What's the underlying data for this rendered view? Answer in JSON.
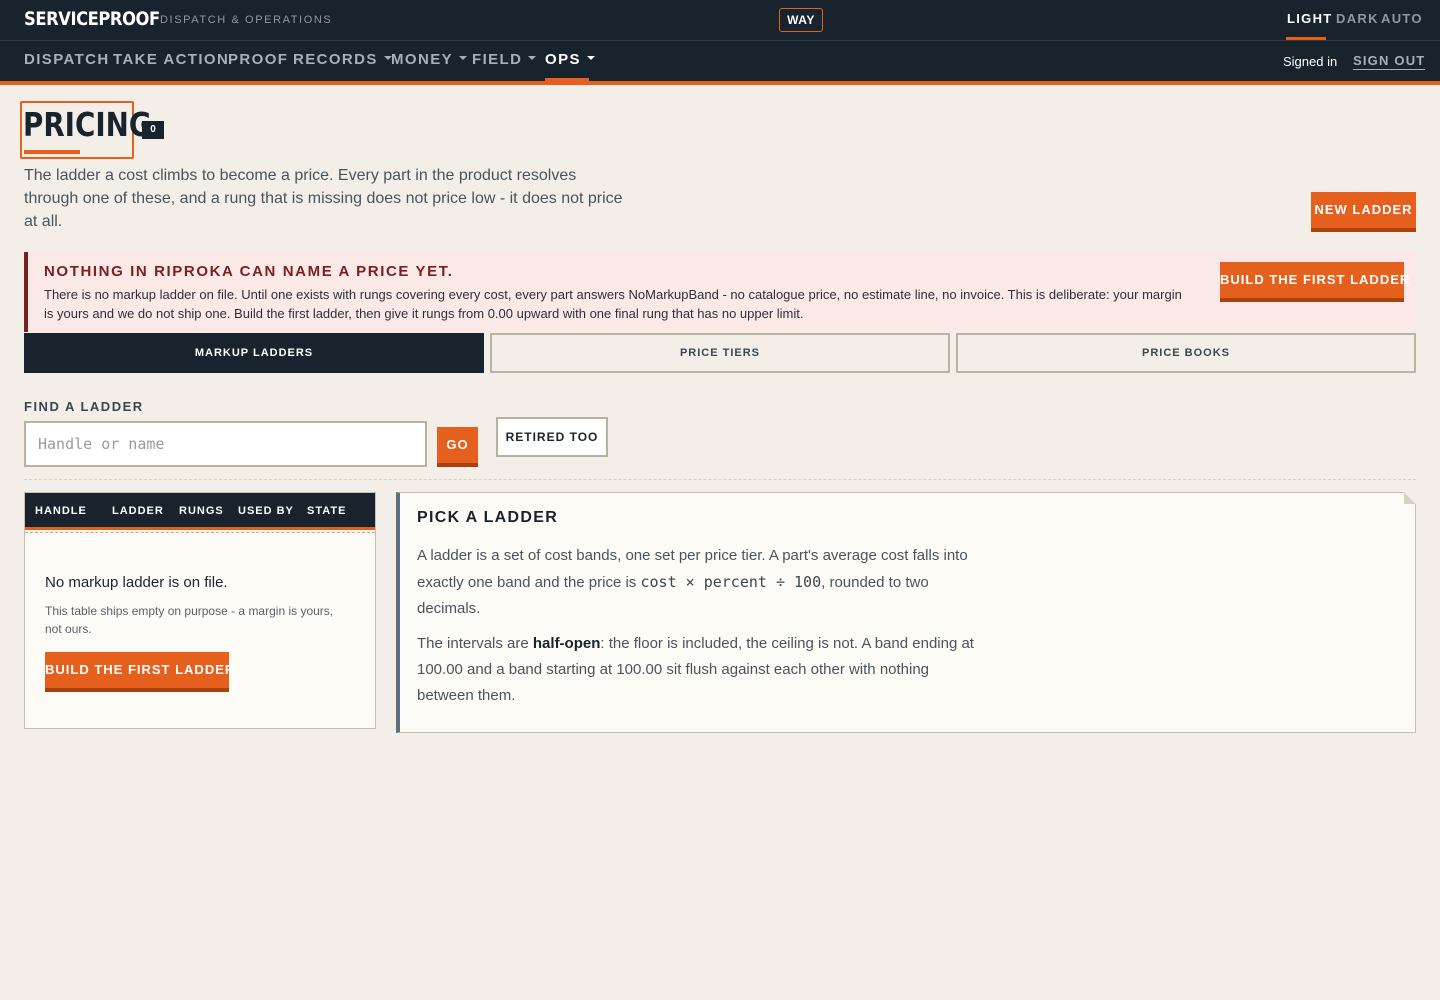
{
  "header": {
    "brand": "SERVICEPROOF",
    "subtitle": "DISPATCH & OPERATIONS",
    "way": "WAY",
    "theme": {
      "light": "LIGHT",
      "dark": "DARK",
      "auto": "AUTO",
      "selected": "LIGHT"
    }
  },
  "nav": {
    "items": [
      {
        "label": "DISPATCH"
      },
      {
        "label": "TAKE ACTION"
      },
      {
        "label": "PROOF"
      },
      {
        "label": "RECORDS"
      },
      {
        "label": "MONEY"
      },
      {
        "label": "FIELD"
      },
      {
        "label": "OPS"
      }
    ],
    "active": "OPS",
    "signed_in": "Signed in",
    "sign_out": "SIGN OUT"
  },
  "page": {
    "title": "PRICING",
    "count": "0",
    "intro": "The ladder a cost climbs to become a price. Every part in the product resolves through one of these, and a rung that is missing does not price low - it does not price at all.",
    "new_ladder": "NEW LADDER"
  },
  "alert": {
    "title": "NOTHING IN RIPROKA CAN NAME A PRICE YET.",
    "body": "There is no markup ladder on file. Until one exists with rungs covering every cost, every part answers NoMarkupBand - no catalogue price, no estimate line, no invoice. This is deliberate: your margin is yours and we do not ship one. Build the first ladder, then give it rungs from 0.00 upward with one final rung that has no upper limit.",
    "button": "BUILD THE FIRST LADDER"
  },
  "tabs": [
    {
      "label": "MARKUP LADDERS"
    },
    {
      "label": "PRICE TIERS"
    },
    {
      "label": "PRICE BOOKS"
    }
  ],
  "search": {
    "label": "FIND A LADDER",
    "placeholder": "Handle or name",
    "value": "",
    "go": "GO",
    "retired": "RETIRED TOO"
  },
  "table": {
    "columns": [
      "HANDLE",
      "LADDER",
      "RUNGS",
      "USED BY",
      "STATE"
    ],
    "empty_title": "No markup ladder is on file.",
    "empty_note": "This table ships empty on purpose - a margin is yours, not ours.",
    "empty_button": "BUILD THE FIRST LADDER"
  },
  "info": {
    "title": "PICK A LADDER",
    "p1_before": "A ladder is a set of cost bands, one set per price tier. A part's average cost falls into exactly one band and the price is ",
    "p1_code": "cost × percent ÷ 100",
    "p1_after": ", rounded to two decimals.",
    "p2_before": "The intervals are ",
    "p2_bold": "half-open",
    "p2_after": ": the floor is included, the ceiling is not. A band ending at 100.00 and a band starting at 100.00 sit flush against each other with nothing between them."
  },
  "colors": {
    "accent": "#e4601c",
    "navy": "#18232d",
    "alert": "#7a1f1f",
    "background": "#f3efe8"
  }
}
